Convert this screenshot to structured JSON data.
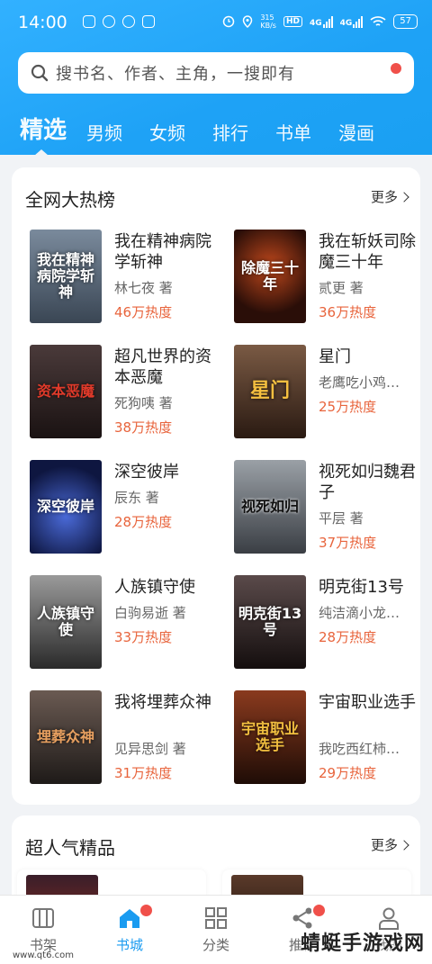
{
  "status": {
    "time": "14:00",
    "net_speed_top": "315",
    "net_speed_unit": "KB/s",
    "hd": "HD",
    "sig1": "4G",
    "sig2": "4G",
    "battery": "57"
  },
  "search": {
    "placeholder": "搜书名、作者、主角，一搜即有"
  },
  "tabs": [
    "精选",
    "男频",
    "女频",
    "排行",
    "书单",
    "漫画"
  ],
  "hot_section": {
    "title": "全网大热榜",
    "more": "更多",
    "books": [
      {
        "title": "我在精神病院学斩神",
        "author": "林七夜 著",
        "heat": "46万热度",
        "cover_text": "我在精神病院学斩神",
        "cover_color": "#5b6a7c"
      },
      {
        "title": "我在斩妖司除魔三十年",
        "author": "贰更 著",
        "heat": "36万热度",
        "cover_text": "除魔三十年",
        "cover_color": "#3a1a12"
      },
      {
        "title": "超凡世界的资本恶魔",
        "author": "死狗咦 著",
        "heat": "38万热度",
        "cover_text": "资本恶魔",
        "cover_color": "#2a2222"
      },
      {
        "title": "星门",
        "author": "老鹰吃小鸡…",
        "heat": "25万热度",
        "cover_text": "星门",
        "cover_color": "#4a2e22"
      },
      {
        "title": "深空彼岸",
        "author": "辰东 著",
        "heat": "28万热度",
        "cover_text": "深空彼岸",
        "cover_color": "#1e2e6e"
      },
      {
        "title": "视死如归魏君子",
        "author": "平层 著",
        "heat": "37万热度",
        "cover_text": "视死如归",
        "cover_color": "#6a6e74"
      },
      {
        "title": "人族镇守使",
        "author": "白驹易逝 著",
        "heat": "33万热度",
        "cover_text": "人族镇守使",
        "cover_color": "#5a5a5a"
      },
      {
        "title": "明克街13号",
        "author": "纯洁滴小龙…",
        "heat": "28万热度",
        "cover_text": "明克街13号",
        "cover_color": "#2e2626"
      },
      {
        "title": "我将埋葬众神",
        "author": "见异思剑 著",
        "heat": "31万热度",
        "cover_text": "埋葬众神",
        "cover_color": "#3a3432"
      },
      {
        "title": "宇宙职业选手",
        "author": "我吃西红柿…",
        "heat": "29万热度",
        "cover_text": "宇宙职业选手",
        "cover_color": "#4a2414"
      }
    ]
  },
  "popular_section": {
    "title": "超人气精品",
    "more": "更多"
  },
  "bottom_nav": [
    {
      "label": "书架",
      "icon": "bookshelf-icon",
      "active": false,
      "badge": false
    },
    {
      "label": "书城",
      "icon": "home-icon",
      "active": true,
      "badge": true
    },
    {
      "label": "分类",
      "icon": "grid-icon",
      "active": false,
      "badge": false
    },
    {
      "label": "推荐",
      "icon": "share-icon",
      "active": false,
      "badge": true
    },
    {
      "label": "我的",
      "icon": "user-icon",
      "active": false,
      "badge": false
    }
  ],
  "watermark": {
    "text": "蜻蜓手游戏网",
    "url": "www.qt6.com"
  },
  "colors": {
    "accent": "#1a9bf0",
    "heat": "#e8643c",
    "badge": "#f0504a"
  }
}
